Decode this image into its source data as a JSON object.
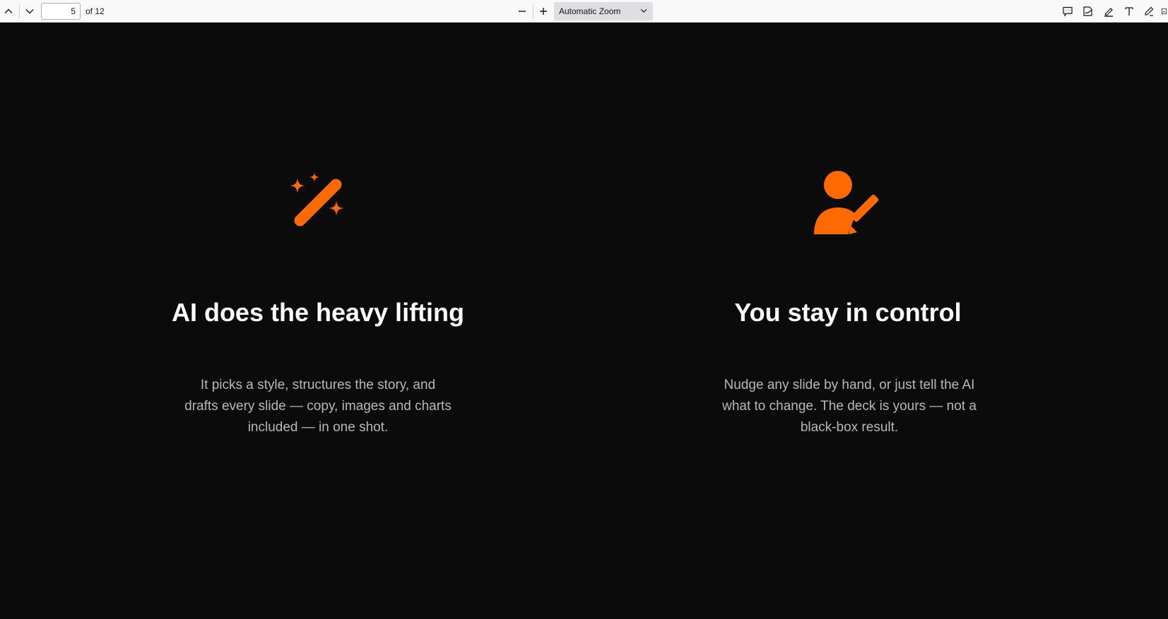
{
  "toolbar": {
    "page_current": "5",
    "page_total_label": "of 12",
    "zoom_label": "Automatic Zoom"
  },
  "slide": {
    "accent_color": "#ff6a00",
    "cards": [
      {
        "icon": "magic-wand-icon",
        "title": "AI does the heavy lifting",
        "body": "It picks a style, structures the story, and drafts every slide — copy, images and charts included — in one shot."
      },
      {
        "icon": "user-edit-icon",
        "title": "You stay in control",
        "body": "Nudge any slide by hand, or just tell the AI what to change. The deck is yours — not a black-box result."
      }
    ]
  }
}
